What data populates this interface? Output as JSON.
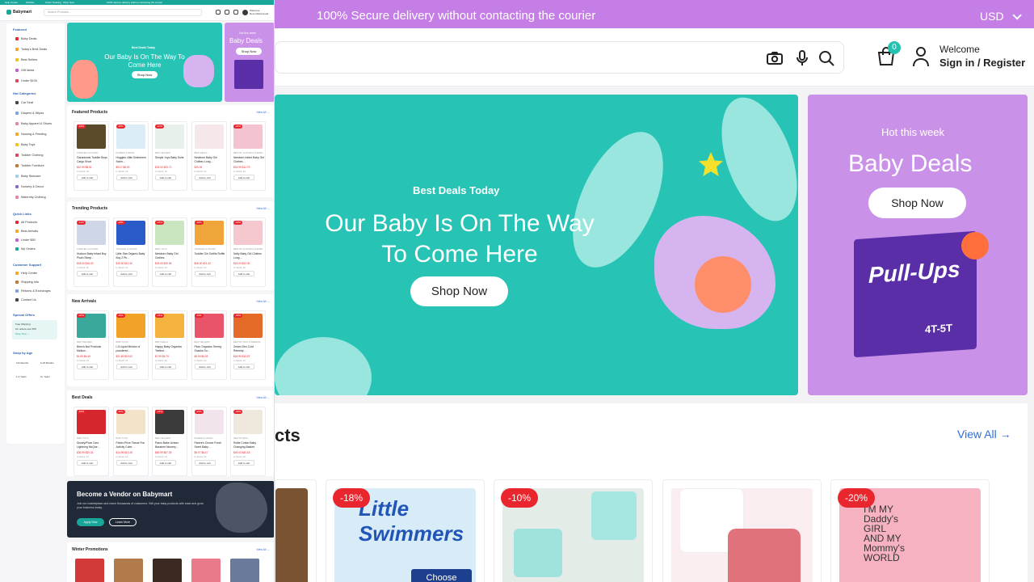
{
  "bg": {
    "topbar": {
      "message": "100% Secure delivery without contacting the courier",
      "currency": "USD"
    },
    "header": {
      "cart_count": "0",
      "welcome": "Welcome",
      "signin": "Sign in / Register"
    },
    "hero": {
      "subtitle": "Best Deals Today",
      "title": "Our Baby Is On The Way To Come Here",
      "button": "Shop Now"
    },
    "side_banner": {
      "eyebrow": "Hot this week",
      "title": "Baby Deals",
      "button": "Shop Now",
      "product_brand": "Pull-Ups",
      "product_size": "4T-5T"
    },
    "products": {
      "title_fragment": "cts",
      "view_all": "View All →",
      "discounts": [
        "-18%",
        "-10%",
        "-20%"
      ],
      "choose_label": "Choose"
    }
  },
  "ov": {
    "topbar": [
      "Help Center",
      "Wishlist",
      "Order Tracking",
      "Shop Now",
      "100% Secure delivery without contacting the courier"
    ],
    "brand": "Babymart",
    "search_placeholder": "Search Products...",
    "user": {
      "line1": "Welcome",
      "line2": "Noor Mohammed"
    },
    "sidebar": {
      "featured_title": "Featured",
      "featured": [
        "Baby Deals",
        "Today's Best Deals",
        "Best Sellers",
        "Gift Ideas",
        "Under $100"
      ],
      "hot_title": "Hot Categories",
      "hot": [
        "Car Seat",
        "Diapers & Wipes",
        "Baby Apparel & Shoes",
        "Nursing & Feeding",
        "Baby Toys",
        "Toddler Clothing",
        "Toddler Furniture",
        "Baby Skincare",
        "Nursery & Decor",
        "Maternity Clothing"
      ],
      "quick_title": "Quick Links",
      "quick": [
        "All Products",
        "Best Arrivals",
        "Under $50",
        "My Orders"
      ],
      "support_title": "Customer Support",
      "support": [
        "Help Center",
        "Shipping Info",
        "Returns & Exchanges",
        "Contact Us"
      ],
      "offers_title": "Special Offers",
      "offer_lines": [
        "Free Shipping",
        "On orders over $75",
        "Shop Now →"
      ],
      "age_title": "Shop by Age",
      "ages": [
        "0-6 Months",
        "6-18 Months",
        "1-2 Years",
        "2+ Years"
      ]
    },
    "hero": {
      "subtitle": "Best Deals Today",
      "title": "Our Baby Is On The Way To Come Here",
      "button": "Shop Now"
    },
    "side": {
      "eyebrow": "Hot this week",
      "title": "Baby Deals",
      "button": "Shop Now"
    },
    "sections": [
      {
        "title": "Featured Products",
        "view_all": "View All →",
        "cards": [
          {
            "disc": "-18%",
            "cat": "TODDLER CLOTHING",
            "name": "Garanimals Toddler Boys Cargo Short",
            "price": "$10.99 $8.51",
            "stock": "In Stock: 10",
            "add": "Add to cart"
          },
          {
            "disc": "-18%",
            "cat": "DIAPERS & WIPES",
            "name": "Huggies Little Swimmers Swim…",
            "price": "$9.17 $8.09",
            "stock": "In Stock: 10",
            "add": "Add to cart"
          },
          {
            "disc": "-10%",
            "cat": "BEST SELLERS",
            "name": "Simple Joys Baby Suits",
            "price": "$33.00 $29.70",
            "stock": "In Stock: 10",
            "add": "Add to cart"
          },
          {
            "disc": "",
            "cat": "BEST DEALS",
            "name": "Newborn Baby Girl Clothes Long…",
            "price": "$25.00",
            "stock": "In Stock: 10",
            "add": "Add to cart"
          },
          {
            "disc": "-20%",
            "cat": "BEST BY CLOTHES & SHOES",
            "name": "Newborn Infant Baby Girl Clothes…",
            "price": "$15.99 $12.79",
            "stock": "In Stock: 10",
            "add": "Add to cart"
          }
        ]
      },
      {
        "title": "Trending Products",
        "view_all": "View All →",
        "cards": [
          {
            "disc": "-11%",
            "cat": "TODDLER CLOTHING",
            "name": "Hudson Baby Infant Boy Plush Sleep…",
            "price": "$18.00 $16.29",
            "stock": "In Stock: 10",
            "add": "Add to cart"
          },
          {
            "disc": "-18%",
            "cat": "TODDLER CLOTHING",
            "name": "Little Star Organic Baby Boy 2 Pk…",
            "price": "$15.00 $12.30",
            "stock": "In Stock: 10",
            "add": "Add to cart"
          },
          {
            "disc": "-15%",
            "cat": "BABY TOYS",
            "name": "Newborn Baby Girl Clothes",
            "price": "$23.00 $19.55",
            "stock": "In Stock: 10",
            "add": "Add to cart"
          },
          {
            "disc": "-18%",
            "cat": "TODDLER CLOTHING",
            "name": "Toddler Girl Outfits Ruffle",
            "price": "$26.00 $21.32",
            "stock": "In Stock: 10",
            "add": "Add to cart"
          },
          {
            "disc": "-18%",
            "cat": "BEST BY CLOTHES & SHOES",
            "name": "Nolly Baby Girl Clothes Long…",
            "price": "$15.00 $12.30",
            "stock": "In Stock: 10",
            "add": "Add to cart"
          }
        ]
      },
      {
        "title": "New Arrivals",
        "view_all": "View All →",
        "cards": [
          {
            "disc": "-10%",
            "cat": "BEST SELLERS",
            "name": "Beech-Nut Probiotic Mellow…",
            "price": "$4.99 $4.49",
            "stock": "In Stock: 10",
            "add": "Add to cart"
          },
          {
            "disc": "-10%",
            "cat": "BABY FOOD",
            "name": "L'il Liquid Mixture of powdered…",
            "price": "$21.69 $19.52",
            "stock": "In Stock: 10",
            "add": "Add to cart"
          },
          {
            "disc": "-15%",
            "cat": "BEST DEALS",
            "name": "Happy Baby Organics Teether…",
            "price": "$7.99 $6.79",
            "stock": "In Stock: 10",
            "add": "Add to cart"
          },
          {
            "disc": "-10%",
            "cat": "BEST SELLERS",
            "name": "Plum Organics Teensy Snacks So…",
            "price": "$5.99 $5.39",
            "stock": "In Stock: 10",
            "add": "Add to cart"
          },
          {
            "disc": "-18%",
            "cat": "BEST BY DAILY & FEEDING",
            "name": "Zmam Zinc Cold Remedy…",
            "price": "$18.99 $15.57",
            "stock": "In Stock: 10",
            "add": "Add to cart"
          }
        ]
      },
      {
        "title": "Best Deals",
        "view_all": "View All →",
        "cards": [
          {
            "disc": "-18%",
            "cat": "BABY TOYS",
            "name": "Disney/Pixar Cars Lightning McQue…",
            "price": "$36.99 $30.33",
            "stock": "In Stock: 10",
            "add": "Add to cart"
          },
          {
            "disc": "-10%",
            "cat": "BABY TOYS",
            "name": "Fisher-Price Tissue Fun Activity Cube…",
            "price": "$14.99 $13.49",
            "stock": "In Stock: 10",
            "add": "Add to cart"
          },
          {
            "disc": "-18%",
            "cat": "BEST SELLERS",
            "name": "Pamo Babe Unisex Bassinet Nursery…",
            "price": "$69.99 $57.39",
            "stock": "In Stock: 10",
            "add": "Add to cart"
          },
          {
            "disc": "-15%",
            "cat": "DIAPERS & WIPES",
            "name": "Parent's Choice Fresh Scent Baby…",
            "price": "$9.97 $8.47",
            "stock": "In Stock: 10",
            "add": "Add to cart"
          },
          {
            "disc": "-18%",
            "cat": "BEST BY BATH",
            "name": "Rollie Cotton Baby Changing Basket",
            "price": "$49.00 $40.18",
            "stock": "In Stock: 10",
            "add": "Add to cart"
          }
        ]
      }
    ],
    "vendor": {
      "title": "Become a Vendor on Babymart",
      "desc": "Join our marketplace and reach thousands of customers. Sell your baby products with ease and grow your business today.",
      "apply": "Apply Now",
      "learn": "Learn More"
    },
    "winter": {
      "title": "Winter Promotions",
      "view_all": "View All →"
    }
  },
  "colors": {
    "teal": "#27c4b6",
    "purple": "#c991e8",
    "topbar_purple": "#c47ee6",
    "sale_red": "#e9262d",
    "link_blue": "#2f6fd6",
    "dark": "#1f2937"
  }
}
